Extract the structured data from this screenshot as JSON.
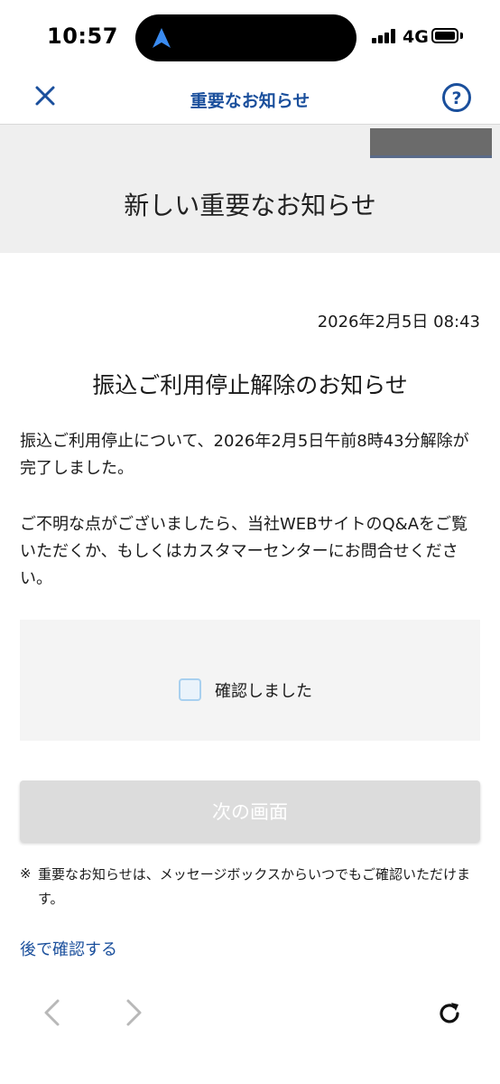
{
  "status_bar": {
    "time": "10:57",
    "network": "4G",
    "icons": [
      "location-arrow-icon",
      "signal-icon",
      "battery-icon"
    ]
  },
  "header": {
    "title": "重要なお知らせ",
    "close_icon": "close-icon",
    "help_icon": "help-icon"
  },
  "banner": {
    "title": "新しい重要なお知らせ"
  },
  "notice": {
    "timestamp": "2026年2月5日 08:43",
    "title": "振込ご利用停止解除のお知らせ",
    "paragraph1": "振込ご利用停止について、2026年2月5日午前8時43分解除が完了しました。",
    "paragraph2": "ご不明な点がございましたら、当社WEBサイトのQ&Aをご覧いただくか、もしくはカスタマーセンターにお問合せください。"
  },
  "confirm": {
    "label": "確認しました",
    "checked": false
  },
  "next_button": {
    "label": "次の画面",
    "enabled": false
  },
  "note": {
    "mark": "※",
    "text": "重要なお知らせは、メッセージボックスからいつでもご確認いただけます。"
  },
  "later_link": {
    "label": "後で確認する"
  },
  "colors": {
    "accent": "#1a4f9c",
    "banner_bg": "#efefef",
    "confirm_bg": "#f4f4f4",
    "disabled_button": "#dcdcdc",
    "checkbox_border": "#a8d0ef"
  },
  "bottom_nav": {
    "icons": [
      "chevron-left-icon",
      "chevron-right-icon",
      "reload-icon"
    ]
  }
}
